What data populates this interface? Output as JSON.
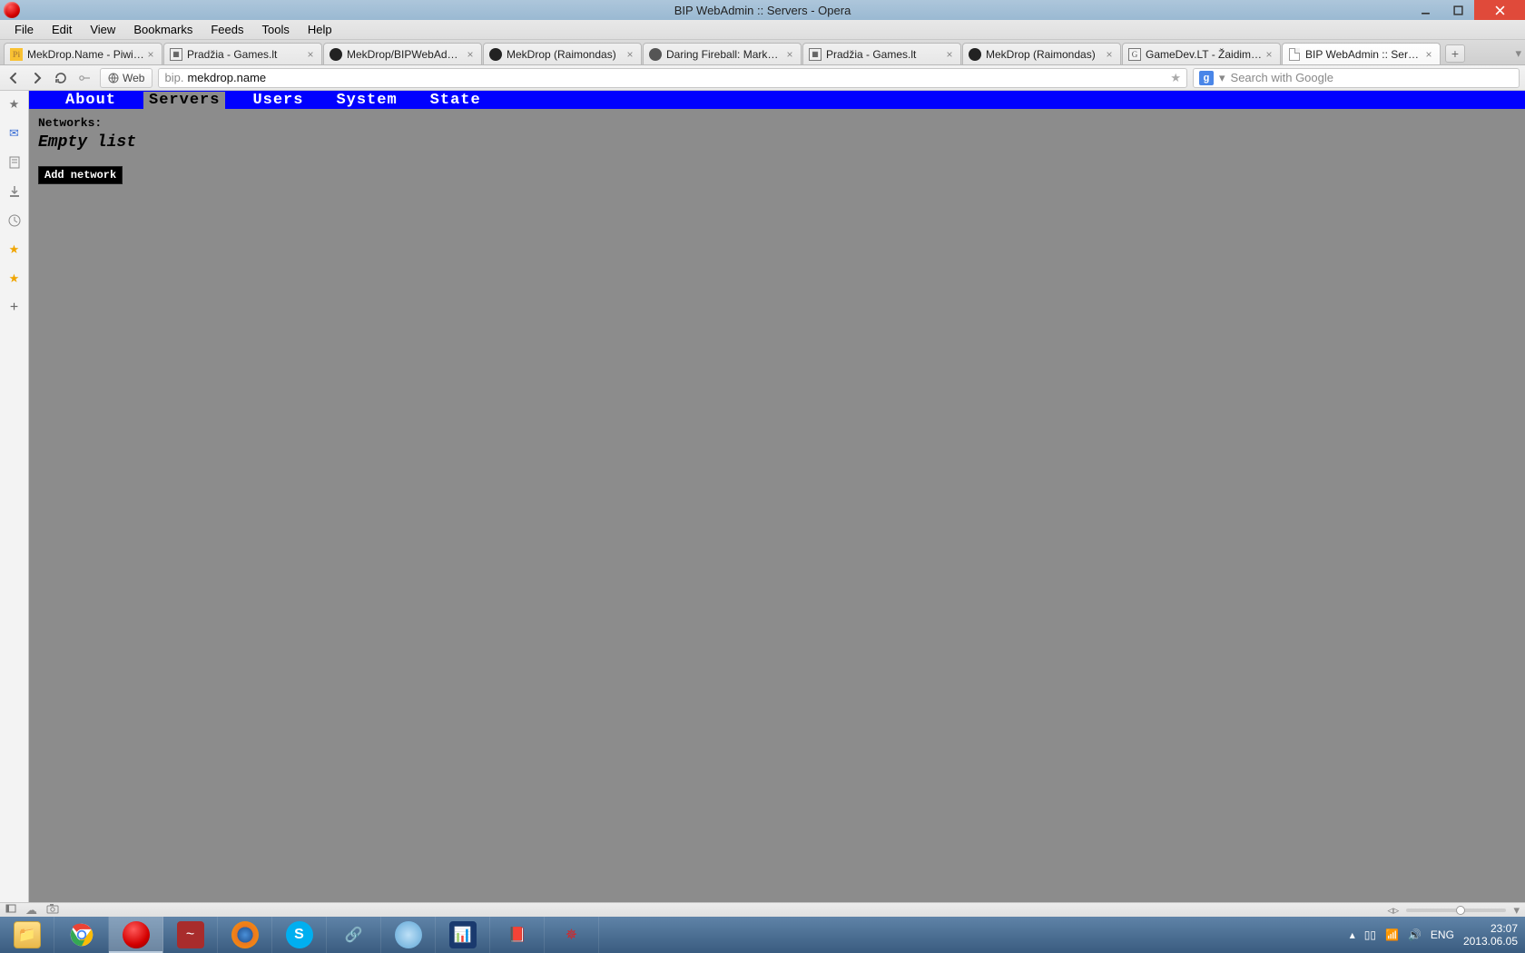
{
  "window": {
    "title": "BIP WebAdmin :: Servers - Opera"
  },
  "menubar": [
    "File",
    "Edit",
    "View",
    "Bookmarks",
    "Feeds",
    "Tools",
    "Help"
  ],
  "tabs": [
    {
      "label": "MekDrop.Name - Piwik..."
    },
    {
      "label": "Pradžia - Games.lt"
    },
    {
      "label": "MekDrop/BIPWebAdm..."
    },
    {
      "label": "MekDrop (Raimondas)"
    },
    {
      "label": "Daring Fireball: Markdo..."
    },
    {
      "label": "Pradžia - Games.lt"
    },
    {
      "label": "MekDrop (Raimondas)"
    },
    {
      "label": "GameDev.LT - Žaidimų..."
    },
    {
      "label": "BIP WebAdmin :: Servers",
      "active": true
    }
  ],
  "addressbar": {
    "web_button": "Web",
    "url_prefix": "bip.",
    "url_host": "mekdrop.name"
  },
  "searchbar": {
    "engine_letter": "g",
    "placeholder": "Search with Google"
  },
  "page": {
    "nav": [
      {
        "label": "About"
      },
      {
        "label": "Servers",
        "active": true
      },
      {
        "label": "Users"
      },
      {
        "label": "System"
      },
      {
        "label": "State"
      }
    ],
    "networks_label": "Networks:",
    "empty_text": "Empty list",
    "add_button": "Add network"
  },
  "tray": {
    "lang": "ENG",
    "time": "23:07",
    "date": "2013.06.05"
  }
}
